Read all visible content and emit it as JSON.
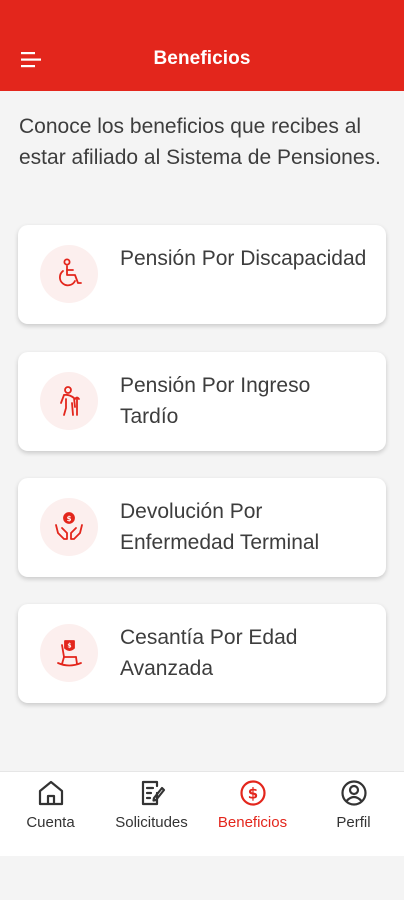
{
  "header": {
    "title": "Beneficios",
    "menu_icon": "hamburger-menu-icon"
  },
  "intro_text": "Conoce los beneficios que recibes al estar afiliado al Sistema de Pensiones.",
  "benefits": [
    {
      "label": "Pensión Por Discapacidad",
      "icon": "wheelchair-icon"
    },
    {
      "label": "Pensión Por Ingreso Tardío",
      "icon": "elderly-person-icon"
    },
    {
      "label": "Devolución Por Enfermedad Terminal",
      "icon": "hands-money-icon"
    },
    {
      "label": "Cesantía Por Edad Avanzada",
      "icon": "rocking-chair-icon"
    }
  ],
  "bottom_nav": [
    {
      "label": "Cuenta",
      "icon": "home-icon",
      "active": false
    },
    {
      "label": "Solicitudes",
      "icon": "document-edit-icon",
      "active": false
    },
    {
      "label": "Beneficios",
      "icon": "dollar-circle-icon",
      "active": true
    },
    {
      "label": "Perfil",
      "icon": "user-circle-icon",
      "active": false
    }
  ],
  "colors": {
    "brand_red": "#e3261c",
    "text": "#3d3d3d",
    "background": "#f4f4f4",
    "icon_bg": "#fcefee"
  }
}
